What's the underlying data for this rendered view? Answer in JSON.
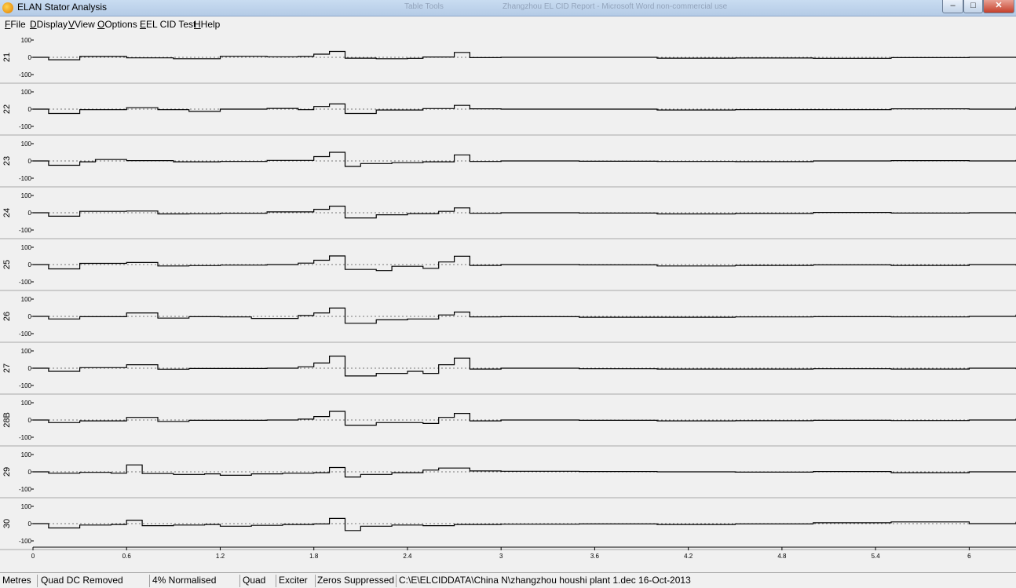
{
  "window": {
    "title": "ELAN Stator Analysis",
    "ghost_titles": [
      "Table Tools",
      "Zhangzhou EL CID Report - Microsoft Word non-commercial use"
    ],
    "buttons": {
      "minimize": "–",
      "maximize": "□",
      "close": "✕"
    }
  },
  "menu": [
    {
      "label": "File",
      "mnemonic": "F"
    },
    {
      "label": "Display",
      "mnemonic": "D"
    },
    {
      "label": "View",
      "mnemonic": "V"
    },
    {
      "label": "Options",
      "mnemonic": "O"
    },
    {
      "label": "EL CID Test",
      "mnemonic": "E"
    },
    {
      "label": "Help",
      "mnemonic": "H"
    }
  ],
  "chart_data": {
    "type": "line",
    "xlim": [
      0,
      6.3
    ],
    "x_ticks": [
      "0",
      "0.6",
      "1.2",
      "1.8",
      "2.4",
      "3",
      "3.6",
      "4.2",
      "4.8",
      "5.4",
      "6"
    ],
    "y_ticks": [
      "100",
      "0",
      "-100"
    ],
    "ylim": [
      -100,
      100
    ],
    "series": [
      {
        "name": "21",
        "points": [
          [
            0,
            0
          ],
          [
            0.1,
            -14
          ],
          [
            0.3,
            5
          ],
          [
            0.6,
            -3
          ],
          [
            0.9,
            -8
          ],
          [
            1.2,
            6
          ],
          [
            1.5,
            3
          ],
          [
            1.7,
            5
          ],
          [
            1.8,
            18
          ],
          [
            1.9,
            34
          ],
          [
            2.0,
            -5
          ],
          [
            2.2,
            -8
          ],
          [
            2.4,
            -6
          ],
          [
            2.5,
            2
          ],
          [
            2.7,
            28
          ],
          [
            2.8,
            -2
          ],
          [
            3.0,
            0
          ],
          [
            3.5,
            0
          ],
          [
            4.0,
            -5
          ],
          [
            4.5,
            -4
          ],
          [
            5.0,
            -6
          ],
          [
            5.5,
            -2
          ],
          [
            6.0,
            0
          ],
          [
            6.3,
            -3
          ]
        ]
      },
      {
        "name": "22",
        "points": [
          [
            0,
            0
          ],
          [
            0.1,
            -25
          ],
          [
            0.3,
            -3
          ],
          [
            0.6,
            8
          ],
          [
            0.8,
            -3
          ],
          [
            1.0,
            -13
          ],
          [
            1.2,
            0
          ],
          [
            1.5,
            4
          ],
          [
            1.7,
            -3
          ],
          [
            1.8,
            15
          ],
          [
            1.9,
            30
          ],
          [
            2.0,
            -25
          ],
          [
            2.2,
            -5
          ],
          [
            2.5,
            3
          ],
          [
            2.7,
            22
          ],
          [
            2.8,
            2
          ],
          [
            3.0,
            0
          ],
          [
            3.5,
            0
          ],
          [
            4.0,
            -5
          ],
          [
            4.5,
            -3
          ],
          [
            5.0,
            -3
          ],
          [
            5.5,
            2
          ],
          [
            6.0,
            0
          ],
          [
            6.3,
            14
          ]
        ]
      },
      {
        "name": "23",
        "points": [
          [
            0,
            0
          ],
          [
            0.1,
            -25
          ],
          [
            0.3,
            -5
          ],
          [
            0.4,
            8
          ],
          [
            0.6,
            2
          ],
          [
            0.9,
            -5
          ],
          [
            1.2,
            -3
          ],
          [
            1.5,
            3
          ],
          [
            1.8,
            25
          ],
          [
            1.9,
            50
          ],
          [
            2.0,
            -32
          ],
          [
            2.1,
            -15
          ],
          [
            2.3,
            -10
          ],
          [
            2.5,
            -5
          ],
          [
            2.7,
            35
          ],
          [
            2.8,
            -3
          ],
          [
            3.0,
            0
          ],
          [
            3.5,
            -2
          ],
          [
            4.0,
            -3
          ],
          [
            4.5,
            -4
          ],
          [
            5.0,
            0
          ],
          [
            5.5,
            2
          ],
          [
            6.0,
            0
          ],
          [
            6.3,
            6
          ]
        ]
      },
      {
        "name": "24",
        "points": [
          [
            0,
            0
          ],
          [
            0.1,
            -20
          ],
          [
            0.3,
            8
          ],
          [
            0.6,
            10
          ],
          [
            0.8,
            -7
          ],
          [
            1.0,
            -6
          ],
          [
            1.2,
            -3
          ],
          [
            1.5,
            5
          ],
          [
            1.8,
            20
          ],
          [
            1.9,
            38
          ],
          [
            2.0,
            -30
          ],
          [
            2.2,
            -12
          ],
          [
            2.4,
            -5
          ],
          [
            2.6,
            8
          ],
          [
            2.7,
            28
          ],
          [
            2.8,
            -3
          ],
          [
            3.0,
            0
          ],
          [
            3.5,
            -2
          ],
          [
            4.0,
            -7
          ],
          [
            4.5,
            -4
          ],
          [
            5.0,
            2
          ],
          [
            5.5,
            -2
          ],
          [
            6.0,
            0
          ],
          [
            6.3,
            -6
          ]
        ]
      },
      {
        "name": "25",
        "points": [
          [
            0,
            0
          ],
          [
            0.1,
            -25
          ],
          [
            0.3,
            7
          ],
          [
            0.6,
            12
          ],
          [
            0.8,
            -8
          ],
          [
            1.0,
            -6
          ],
          [
            1.2,
            -3
          ],
          [
            1.5,
            0
          ],
          [
            1.7,
            8
          ],
          [
            1.8,
            25
          ],
          [
            1.9,
            50
          ],
          [
            2.0,
            -28
          ],
          [
            2.2,
            -35
          ],
          [
            2.3,
            -10
          ],
          [
            2.5,
            -22
          ],
          [
            2.6,
            15
          ],
          [
            2.7,
            48
          ],
          [
            2.8,
            -5
          ],
          [
            3.0,
            0
          ],
          [
            3.5,
            -2
          ],
          [
            4.0,
            -8
          ],
          [
            4.5,
            -5
          ],
          [
            5.0,
            -2
          ],
          [
            5.5,
            -5
          ],
          [
            6.0,
            0
          ],
          [
            6.3,
            -6
          ]
        ]
      },
      {
        "name": "26",
        "points": [
          [
            0,
            0
          ],
          [
            0.1,
            -15
          ],
          [
            0.3,
            -2
          ],
          [
            0.6,
            20
          ],
          [
            0.8,
            -10
          ],
          [
            1.0,
            -2
          ],
          [
            1.2,
            -3
          ],
          [
            1.4,
            -12
          ],
          [
            1.7,
            5
          ],
          [
            1.8,
            20
          ],
          [
            1.9,
            48
          ],
          [
            2.0,
            -40
          ],
          [
            2.2,
            -20
          ],
          [
            2.4,
            -15
          ],
          [
            2.6,
            8
          ],
          [
            2.7,
            25
          ],
          [
            2.8,
            -3
          ],
          [
            3.0,
            -2
          ],
          [
            3.5,
            -5
          ],
          [
            4.0,
            -5
          ],
          [
            4.5,
            -3
          ],
          [
            5.0,
            -2
          ],
          [
            5.5,
            -3
          ],
          [
            6.0,
            0
          ],
          [
            6.3,
            10
          ]
        ]
      },
      {
        "name": "27",
        "points": [
          [
            0,
            0
          ],
          [
            0.1,
            -18
          ],
          [
            0.3,
            3
          ],
          [
            0.6,
            20
          ],
          [
            0.8,
            -6
          ],
          [
            1.0,
            -2
          ],
          [
            1.2,
            -2
          ],
          [
            1.5,
            0
          ],
          [
            1.7,
            8
          ],
          [
            1.8,
            30
          ],
          [
            1.9,
            70
          ],
          [
            2.0,
            -45
          ],
          [
            2.2,
            -30
          ],
          [
            2.4,
            -18
          ],
          [
            2.5,
            -30
          ],
          [
            2.6,
            20
          ],
          [
            2.7,
            58
          ],
          [
            2.8,
            -5
          ],
          [
            3.0,
            0
          ],
          [
            3.5,
            -3
          ],
          [
            4.0,
            -5
          ],
          [
            4.5,
            -5
          ],
          [
            5.0,
            -3
          ],
          [
            5.5,
            -5
          ],
          [
            6.0,
            0
          ],
          [
            6.3,
            -5
          ]
        ]
      },
      {
        "name": "28B",
        "points": [
          [
            0,
            0
          ],
          [
            0.1,
            -15
          ],
          [
            0.3,
            -5
          ],
          [
            0.6,
            15
          ],
          [
            0.8,
            -8
          ],
          [
            1.0,
            -2
          ],
          [
            1.2,
            -2
          ],
          [
            1.5,
            0
          ],
          [
            1.7,
            5
          ],
          [
            1.8,
            20
          ],
          [
            1.9,
            50
          ],
          [
            2.0,
            -30
          ],
          [
            2.2,
            -15
          ],
          [
            2.4,
            -15
          ],
          [
            2.5,
            -20
          ],
          [
            2.6,
            15
          ],
          [
            2.7,
            38
          ],
          [
            2.8,
            -5
          ],
          [
            3.0,
            0
          ],
          [
            3.5,
            -2
          ],
          [
            4.0,
            -5
          ],
          [
            4.5,
            -4
          ],
          [
            5.0,
            -2
          ],
          [
            5.5,
            -3
          ],
          [
            6.0,
            0
          ],
          [
            6.3,
            8
          ]
        ]
      },
      {
        "name": "29",
        "points": [
          [
            0,
            0
          ],
          [
            0.1,
            -8
          ],
          [
            0.3,
            -3
          ],
          [
            0.5,
            -8
          ],
          [
            0.6,
            40
          ],
          [
            0.7,
            -10
          ],
          [
            0.9,
            -15
          ],
          [
            1.1,
            -12
          ],
          [
            1.2,
            -20
          ],
          [
            1.4,
            -12
          ],
          [
            1.6,
            -8
          ],
          [
            1.8,
            -5
          ],
          [
            1.9,
            25
          ],
          [
            2.0,
            -30
          ],
          [
            2.1,
            -15
          ],
          [
            2.3,
            -5
          ],
          [
            2.5,
            10
          ],
          [
            2.6,
            22
          ],
          [
            2.8,
            5
          ],
          [
            3.0,
            3
          ],
          [
            3.5,
            2
          ],
          [
            4.0,
            0
          ],
          [
            4.5,
            -2
          ],
          [
            5.0,
            2
          ],
          [
            5.5,
            -5
          ],
          [
            6.0,
            0
          ],
          [
            6.3,
            -2
          ]
        ]
      },
      {
        "name": "30",
        "points": [
          [
            0,
            0
          ],
          [
            0.1,
            -25
          ],
          [
            0.3,
            -8
          ],
          [
            0.5,
            -5
          ],
          [
            0.6,
            20
          ],
          [
            0.7,
            -12
          ],
          [
            0.9,
            -8
          ],
          [
            1.1,
            -5
          ],
          [
            1.2,
            -15
          ],
          [
            1.4,
            -10
          ],
          [
            1.6,
            -5
          ],
          [
            1.8,
            -2
          ],
          [
            1.9,
            30
          ],
          [
            2.0,
            -40
          ],
          [
            2.1,
            -15
          ],
          [
            2.3,
            -8
          ],
          [
            2.5,
            -12
          ],
          [
            2.7,
            -5
          ],
          [
            3.0,
            -3
          ],
          [
            3.5,
            -2
          ],
          [
            4.0,
            -5
          ],
          [
            4.5,
            -2
          ],
          [
            5.0,
            5
          ],
          [
            5.5,
            10
          ],
          [
            6.0,
            0
          ],
          [
            6.3,
            10
          ]
        ]
      }
    ]
  },
  "status": [
    {
      "text": "Metres"
    },
    {
      "text": "Quad DC Removed"
    },
    {
      "text": "4% Normalised"
    },
    {
      "text": "Quad"
    },
    {
      "text": "Exciter"
    },
    {
      "text": "Zeros Suppressed"
    },
    {
      "text": "C:\\E\\ELCIDDATA\\China N\\zhangzhou houshi plant 1.dec 16-Oct-2013"
    }
  ]
}
